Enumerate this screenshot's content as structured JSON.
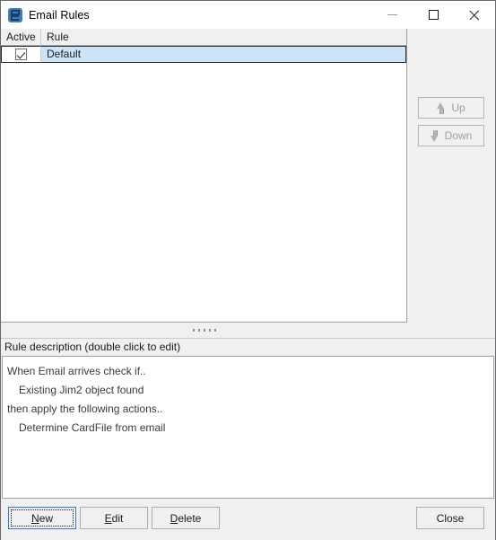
{
  "window": {
    "title": "Email Rules",
    "app_icon": "email-rules-icon",
    "controls": {
      "minimize": "minimize-icon",
      "maximize": "maximize-icon",
      "close": "close-icon"
    }
  },
  "rules_list": {
    "columns": [
      "Active",
      "Rule"
    ],
    "rows": [
      {
        "active": true,
        "rule": "Default",
        "selected": true
      }
    ]
  },
  "side_buttons": {
    "up_label": "Up",
    "down_label": "Down",
    "up_enabled": false,
    "down_enabled": false
  },
  "description": {
    "header": "Rule description (double click to edit)",
    "lines": [
      {
        "text": "When Email arrives check if..",
        "indent": false
      },
      {
        "text": "Existing Jim2 object found",
        "indent": true
      },
      {
        "text": "then apply the following actions..",
        "indent": false
      },
      {
        "text": "Determine CardFile from email",
        "indent": true
      }
    ]
  },
  "buttons": {
    "new": {
      "pre": "",
      "mnemonic": "N",
      "post": "ew"
    },
    "edit": {
      "pre": "",
      "mnemonic": "E",
      "post": "dit"
    },
    "delete": {
      "pre": "",
      "mnemonic": "D",
      "post": "elete"
    },
    "close": {
      "label": "Close"
    }
  },
  "colors": {
    "window_bg": "#f0f0f0",
    "titlebar_bg": "#ffffff",
    "selection": "#cce4f7",
    "accent": "#2b7ad1",
    "icon_blue": "#3a7cc0",
    "border": "#a0a0a0",
    "disabled_text": "#a0a0a0"
  }
}
